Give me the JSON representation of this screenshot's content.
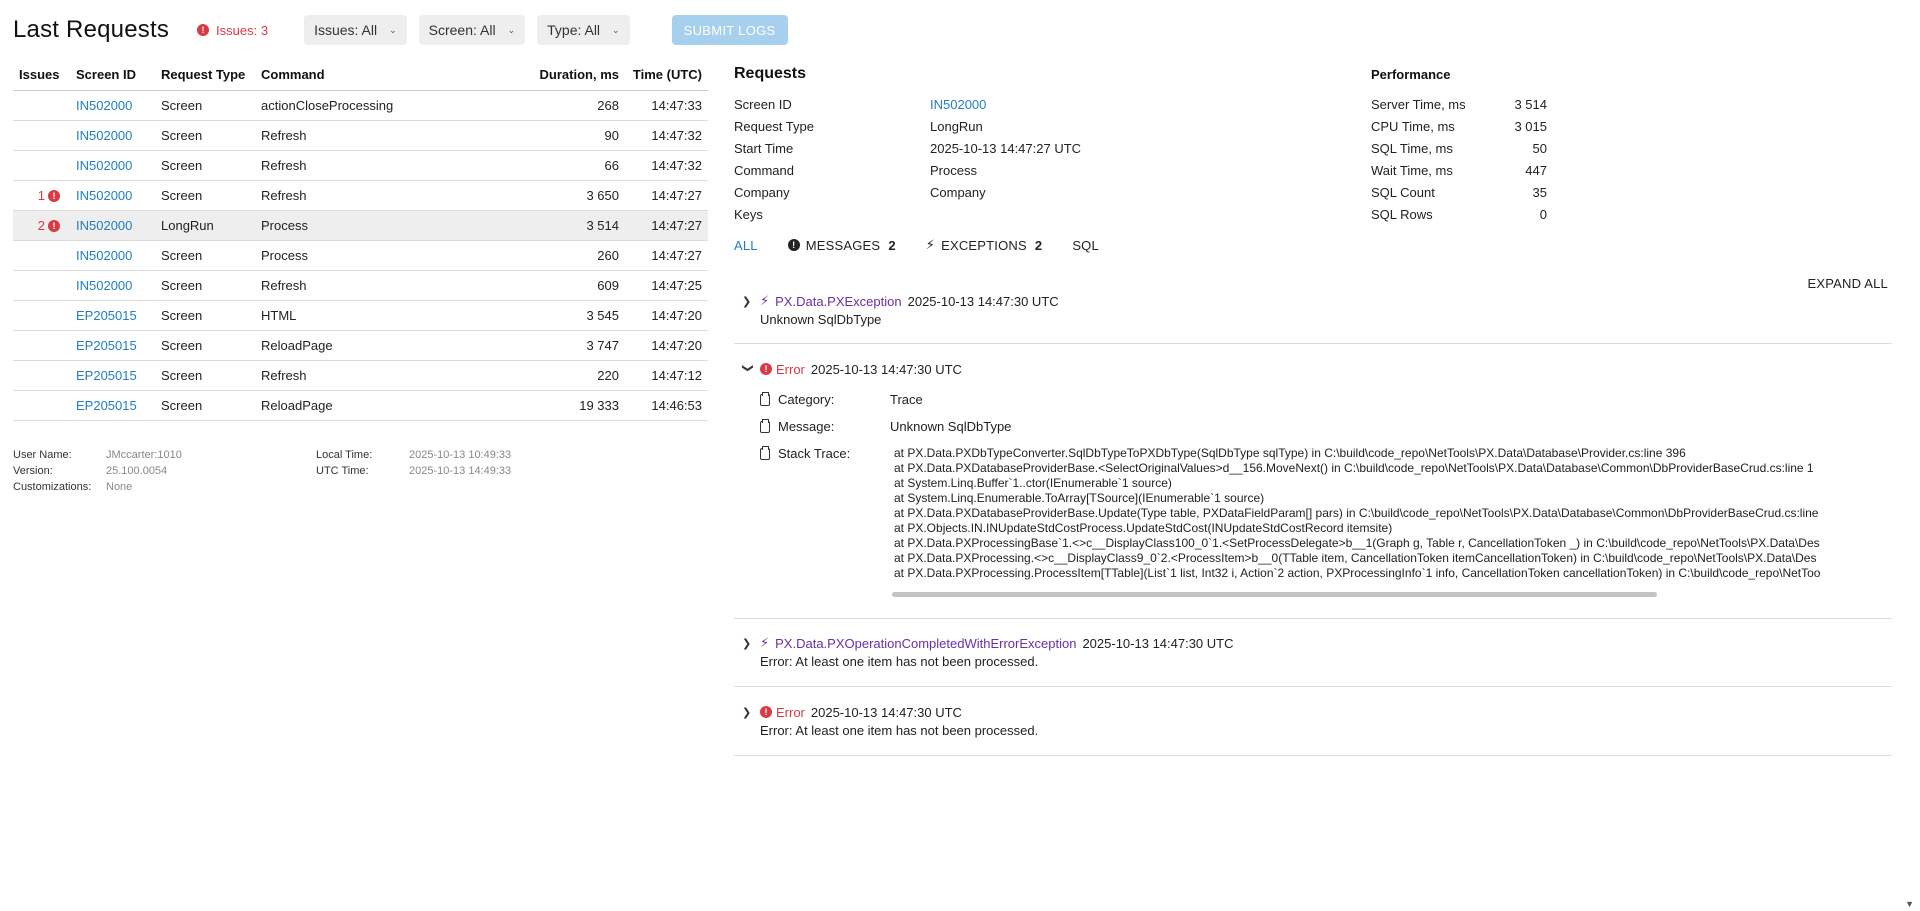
{
  "header": {
    "title": "Last Requests",
    "issues_label": "Issues: 3",
    "filters": [
      {
        "label": "Issues: All"
      },
      {
        "label": "Screen: All"
      },
      {
        "label": "Type: All"
      }
    ],
    "submit_label": "SUBMIT LOGS"
  },
  "table": {
    "columns": [
      "Issues",
      "Screen ID",
      "Request Type",
      "Command",
      "Duration, ms",
      "Time (UTC)"
    ],
    "rows": [
      {
        "issues": "",
        "screen": "IN502000",
        "type": "Screen",
        "command": "actionCloseProcessing",
        "duration": "268",
        "time": "14:47:33",
        "selected": false
      },
      {
        "issues": "",
        "screen": "IN502000",
        "type": "Screen",
        "command": "Refresh",
        "duration": "90",
        "time": "14:47:32",
        "selected": false
      },
      {
        "issues": "",
        "screen": "IN502000",
        "type": "Screen",
        "command": "Refresh",
        "duration": "66",
        "time": "14:47:32",
        "selected": false
      },
      {
        "issues": "1",
        "screen": "IN502000",
        "type": "Screen",
        "command": "Refresh",
        "duration": "3 650",
        "time": "14:47:27",
        "selected": false
      },
      {
        "issues": "2",
        "screen": "IN502000",
        "type": "LongRun",
        "command": "Process",
        "duration": "3 514",
        "time": "14:47:27",
        "selected": true
      },
      {
        "issues": "",
        "screen": "IN502000",
        "type": "Screen",
        "command": "Process",
        "duration": "260",
        "time": "14:47:27",
        "selected": false
      },
      {
        "issues": "",
        "screen": "IN502000",
        "type": "Screen",
        "command": "Refresh",
        "duration": "609",
        "time": "14:47:25",
        "selected": false
      },
      {
        "issues": "",
        "screen": "EP205015",
        "type": "Screen",
        "command": "HTML",
        "duration": "3 545",
        "time": "14:47:20",
        "selected": false
      },
      {
        "issues": "",
        "screen": "EP205015",
        "type": "Screen",
        "command": "ReloadPage",
        "duration": "3 747",
        "time": "14:47:20",
        "selected": false
      },
      {
        "issues": "",
        "screen": "EP205015",
        "type": "Screen",
        "command": "Refresh",
        "duration": "220",
        "time": "14:47:12",
        "selected": false
      },
      {
        "issues": "",
        "screen": "EP205015",
        "type": "Screen",
        "command": "ReloadPage",
        "duration": "19 333",
        "time": "14:46:53",
        "selected": false
      }
    ]
  },
  "user_info": {
    "user_name_label": "User Name:",
    "user_name": "JMccarter:1010",
    "version_label": "Version:",
    "version": "25.100.0054",
    "custom_label": "Customizations:",
    "custom": "None",
    "local_time_label": "Local Time:",
    "local_time": "2025-10-13 10:49:33",
    "utc_time_label": "UTC Time:",
    "utc_time": "2025-10-13 14:49:33"
  },
  "requests": {
    "title": "Requests",
    "fields": [
      {
        "label": "Screen ID",
        "value": "IN502000"
      },
      {
        "label": "Request Type",
        "value": "LongRun"
      },
      {
        "label": "Start Time",
        "value": "2025-10-13 14:47:27 UTC"
      },
      {
        "label": "Command",
        "value": "Process"
      },
      {
        "label": "Company",
        "value": "Company"
      },
      {
        "label": "Keys",
        "value": ""
      }
    ]
  },
  "performance": {
    "title": "Performance",
    "fields": [
      {
        "label": "Server Time, ms",
        "value": "3 514"
      },
      {
        "label": "CPU Time, ms",
        "value": "3 015"
      },
      {
        "label": "SQL Time, ms",
        "value": "50"
      },
      {
        "label": "Wait Time, ms",
        "value": "447"
      },
      {
        "label": "SQL Count",
        "value": "35"
      },
      {
        "label": "SQL Rows",
        "value": "0"
      }
    ]
  },
  "tabs": {
    "all": "ALL",
    "messages": "MESSAGES",
    "messages_count": "2",
    "exceptions": "EXCEPTIONS",
    "exceptions_count": "2",
    "sql": "SQL"
  },
  "expand_all": "EXPAND ALL",
  "entries": {
    "e1": {
      "name": "PX.Data.PXException",
      "time": "2025-10-13 14:47:30 UTC",
      "text": "Unknown SqlDbType"
    },
    "e2": {
      "name": "Error",
      "time": "2025-10-13 14:47:30 UTC",
      "category_label": "Category:",
      "category": "Trace",
      "message_label": "Message:",
      "message": "Unknown SqlDbType",
      "stack_label": "Stack Trace:",
      "stack": [
        "at PX.Data.PXDbTypeConverter.SqlDbTypeToPXDbType(SqlDbType sqlType) in C:\\build\\code_repo\\NetTools\\PX.Data\\Database\\Provider.cs:line 396",
        "at PX.Data.PXDatabaseProviderBase.<SelectOriginalValues>d__156.MoveNext() in C:\\build\\code_repo\\NetTools\\PX.Data\\Database\\Common\\DbProviderBaseCrud.cs:line 1",
        "at System.Linq.Buffer`1..ctor(IEnumerable`1 source)",
        "at System.Linq.Enumerable.ToArray[TSource](IEnumerable`1 source)",
        "at PX.Data.PXDatabaseProviderBase.Update(Type table, PXDataFieldParam[] pars) in C:\\build\\code_repo\\NetTools\\PX.Data\\Database\\Common\\DbProviderBaseCrud.cs:line",
        "at PX.Objects.IN.INUpdateStdCostProcess.UpdateStdCost(INUpdateStdCostRecord itemsite)",
        "at PX.Data.PXProcessingBase`1.<>c__DisplayClass100_0`1.<SetProcessDelegate>b__1(Graph g, Table r, CancellationToken _) in C:\\build\\code_repo\\NetTools\\PX.Data\\Des",
        "at PX.Data.PXProcessing.<>c__DisplayClass9_0`2.<ProcessItem>b__0(TTable item, CancellationToken itemCancellationToken) in C:\\build\\code_repo\\NetTools\\PX.Data\\Des",
        "at PX.Data.PXProcessing.ProcessItem[TTable](List`1 list, Int32 i, Action`2 action, PXProcessingInfo`1 info, CancellationToken cancellationToken) in C:\\build\\code_repo\\NetToo"
      ]
    },
    "e3": {
      "name": "PX.Data.PXOperationCompletedWithErrorException",
      "time": "2025-10-13 14:47:30 UTC",
      "text": "Error: At least one item has not been processed."
    },
    "e4": {
      "name": "Error",
      "time": "2025-10-13 14:47:30 UTC",
      "text": "Error: At least one item has not been processed."
    }
  },
  "icons": {
    "error": "exclamation-circle-icon",
    "exception": "lightning-bolt-icon",
    "detail": "clipboard-icon"
  },
  "colors": {
    "error": "#d93a45",
    "link": "#1f7fc2",
    "exception": "#6a2fa6",
    "submit": "#a7cfee"
  }
}
